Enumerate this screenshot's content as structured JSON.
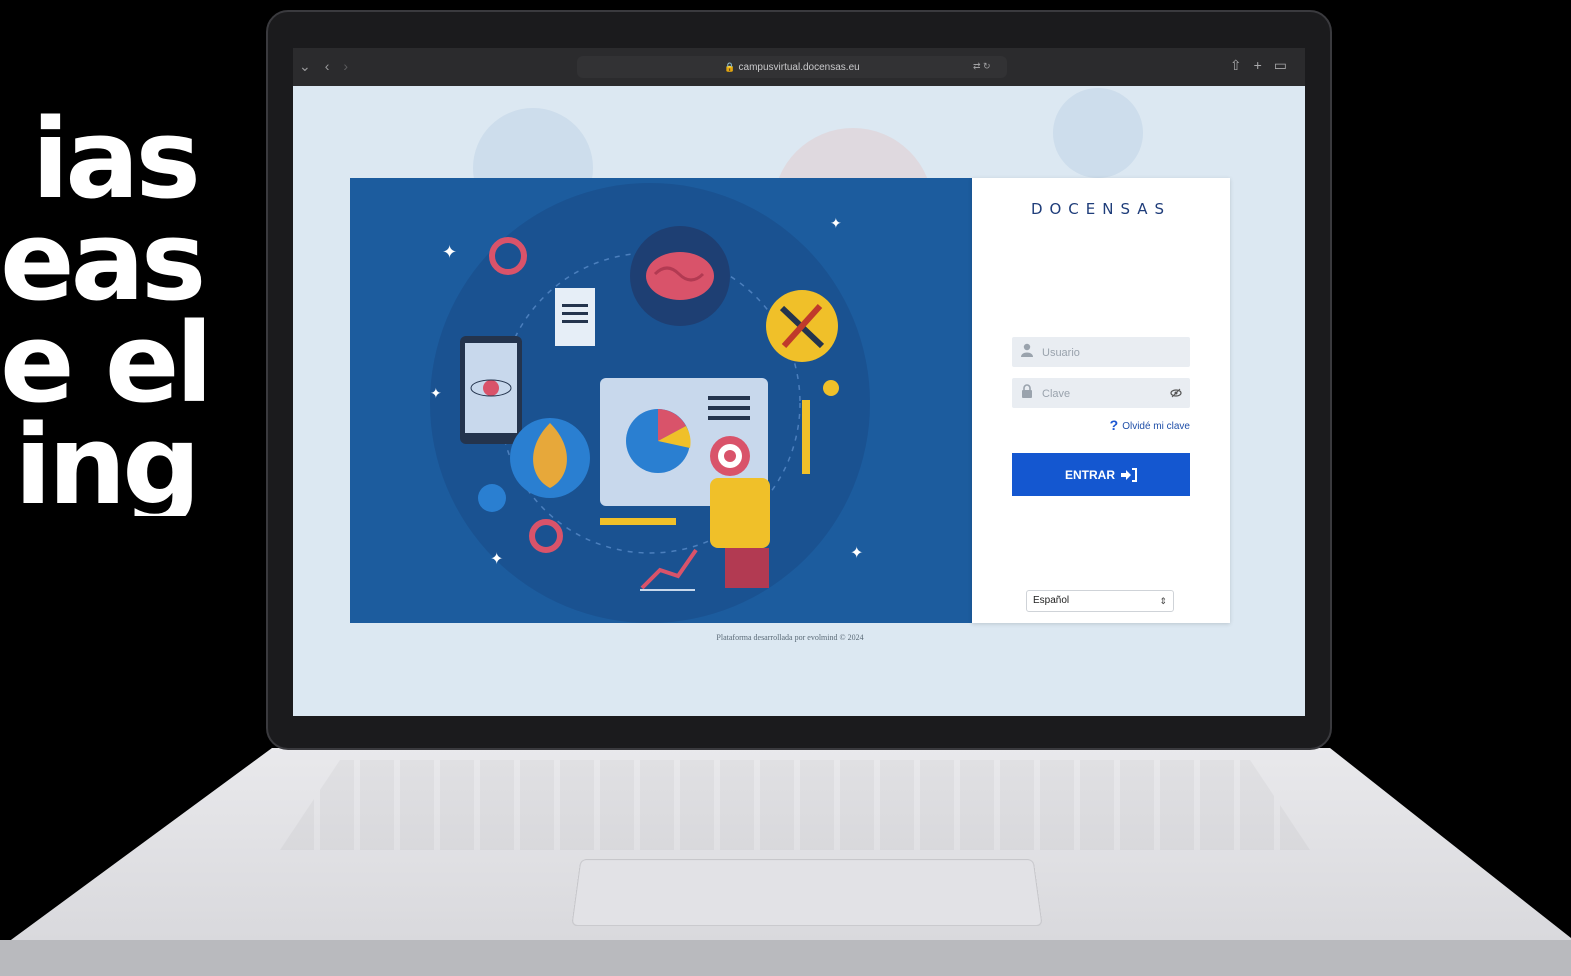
{
  "headline": {
    "lines": [
      "ias",
      "eas",
      "e el",
      "ing"
    ]
  },
  "browser": {
    "url": "campusvirtual.docensas.eu",
    "nav_icons": [
      "chevron-down-icon",
      "back-icon",
      "forward-icon"
    ],
    "right_icons": [
      "share-icon",
      "new-tab-icon",
      "tabs-icon"
    ]
  },
  "login": {
    "logo": "DOCENSAS",
    "username_placeholder": "Usuario",
    "password_placeholder": "Clave",
    "forgot_label": "Olvidé mi clave",
    "submit_label": "ENTRAR",
    "language_selected": "Español"
  },
  "footer": {
    "text": "Plataforma desarrollada por evolmind © 2024"
  },
  "colors": {
    "illustration_bg": "#1c5c9e",
    "primary_button": "#1457d0",
    "logo_text": "#1f3d7a",
    "logo_accent": "#3bb38f"
  }
}
